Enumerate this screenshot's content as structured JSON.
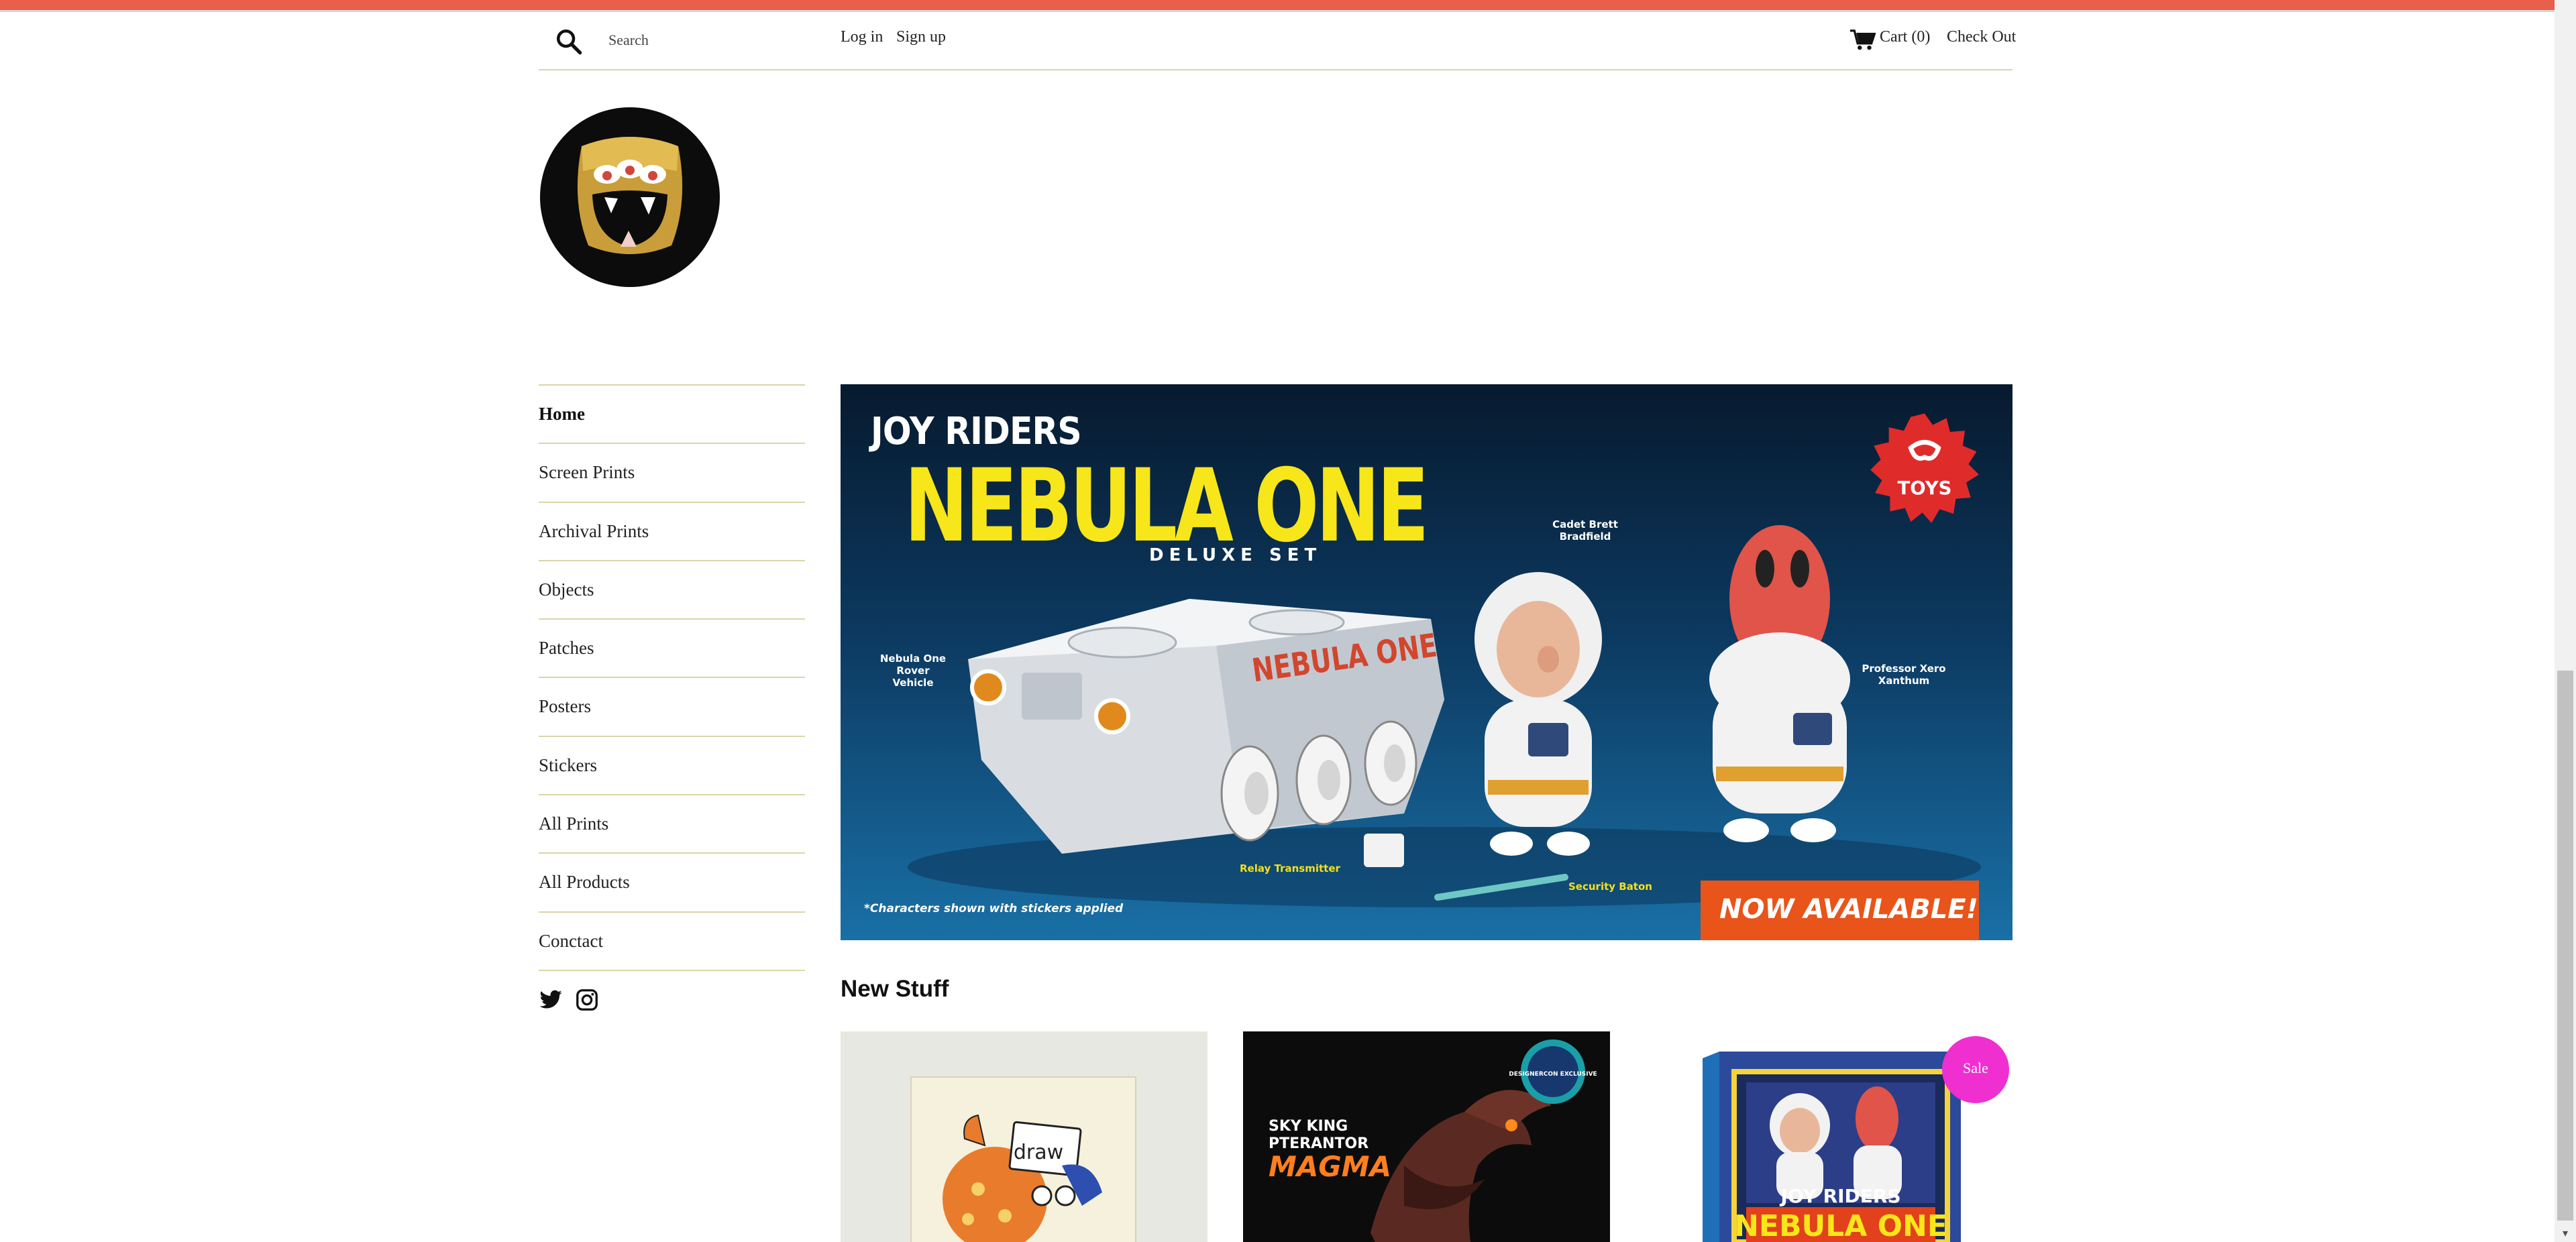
{
  "header": {
    "search_placeholder": "Search",
    "login_label": "Log in",
    "signup_label": "Sign up",
    "cart_label": "Cart (0)",
    "checkout_label": "Check Out",
    "icons": [
      "search-icon",
      "cart-icon"
    ]
  },
  "colors": {
    "top_bar": "#e8604c",
    "divider": "#d9d6a8",
    "sale_badge": "#f02fd1",
    "banner_headline": "#f7e619",
    "banner_cta": "#e8541a"
  },
  "sidebar": {
    "items": [
      {
        "label": "Home",
        "active": true
      },
      {
        "label": "Screen Prints",
        "active": false
      },
      {
        "label": "Archival Prints",
        "active": false
      },
      {
        "label": "Objects",
        "active": false
      },
      {
        "label": "Patches",
        "active": false
      },
      {
        "label": "Posters",
        "active": false
      },
      {
        "label": "Stickers",
        "active": false
      },
      {
        "label": "All Prints",
        "active": false
      },
      {
        "label": "All Products",
        "active": false
      },
      {
        "label": "Conctact",
        "active": false
      }
    ],
    "social_icons": [
      "twitter-icon",
      "instagram-icon"
    ]
  },
  "banner": {
    "brand": "JOY RIDERS",
    "title": "NEBULA ONE",
    "subtitle": "DELUXE SET",
    "badge_text": "TOYS",
    "label_vehicle": "Nebula One Rover Vehicle",
    "label_cadet": "Cadet Brett Bradfield",
    "label_professor": "Professor Xero Xanthum",
    "label_relay": "Relay Transmitter",
    "label_baton": "Security Baton",
    "vehicle_text": "NEBULA ONE",
    "footnote": "*Characters shown with stickers applied",
    "cta": "NOW AVAILABLE!"
  },
  "main": {
    "section_title": "New Stuff",
    "products": [
      {
        "image_text": "draw",
        "sale": false
      },
      {
        "image_text_1": "SKY KING",
        "image_text_2": "PTERANTOR",
        "image_text_3": "MAGMA",
        "image_badge": "DESIGNERCON EXCLUSIVE",
        "sale": false
      },
      {
        "image_text_1": "JOY RIDERS",
        "image_text_2": "NEBULA ONE",
        "sale": true,
        "sale_label": "Sale"
      }
    ]
  }
}
